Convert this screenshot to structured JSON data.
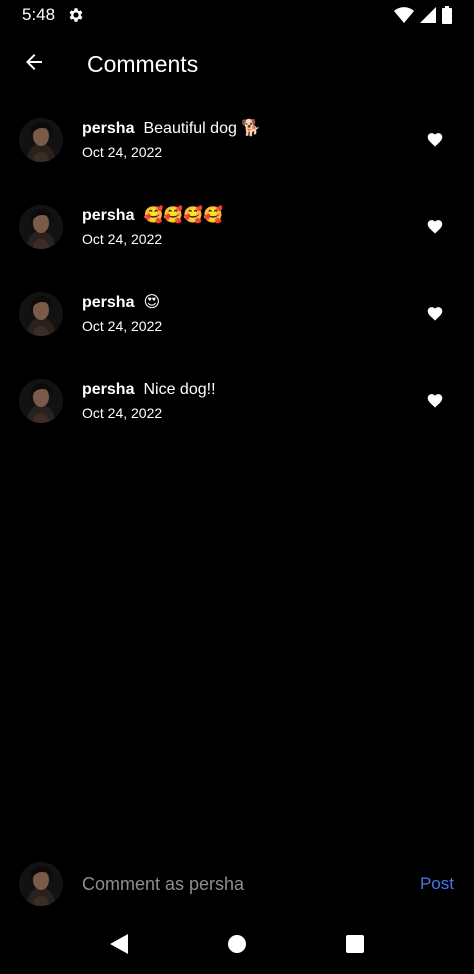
{
  "status_bar": {
    "time": "5:48",
    "icons": [
      "gear-icon",
      "wifi-icon",
      "signal-icon",
      "battery-icon"
    ]
  },
  "header": {
    "title": "Comments",
    "back_icon": "arrow-left-icon"
  },
  "comments": [
    {
      "username": "persha",
      "text": "Beautiful dog 🐕",
      "date": "Oct 24, 2022"
    },
    {
      "username": "persha",
      "text": "🥰🥰🥰🥰",
      "date": "Oct 24, 2022"
    },
    {
      "username": "persha",
      "text": "😍",
      "date": "Oct 24, 2022"
    },
    {
      "username": "persha",
      "text": "Nice dog!!",
      "date": "Oct 24, 2022"
    }
  ],
  "composer": {
    "placeholder": "Comment as persha",
    "post_label": "Post"
  },
  "colors": {
    "background": "#000000",
    "accent": "#4a74e8",
    "text": "#ffffff",
    "placeholder": "#8e8e8e"
  },
  "nav_bar": {
    "icons": [
      "back-triangle-icon",
      "home-circle-icon",
      "recents-square-icon"
    ]
  }
}
